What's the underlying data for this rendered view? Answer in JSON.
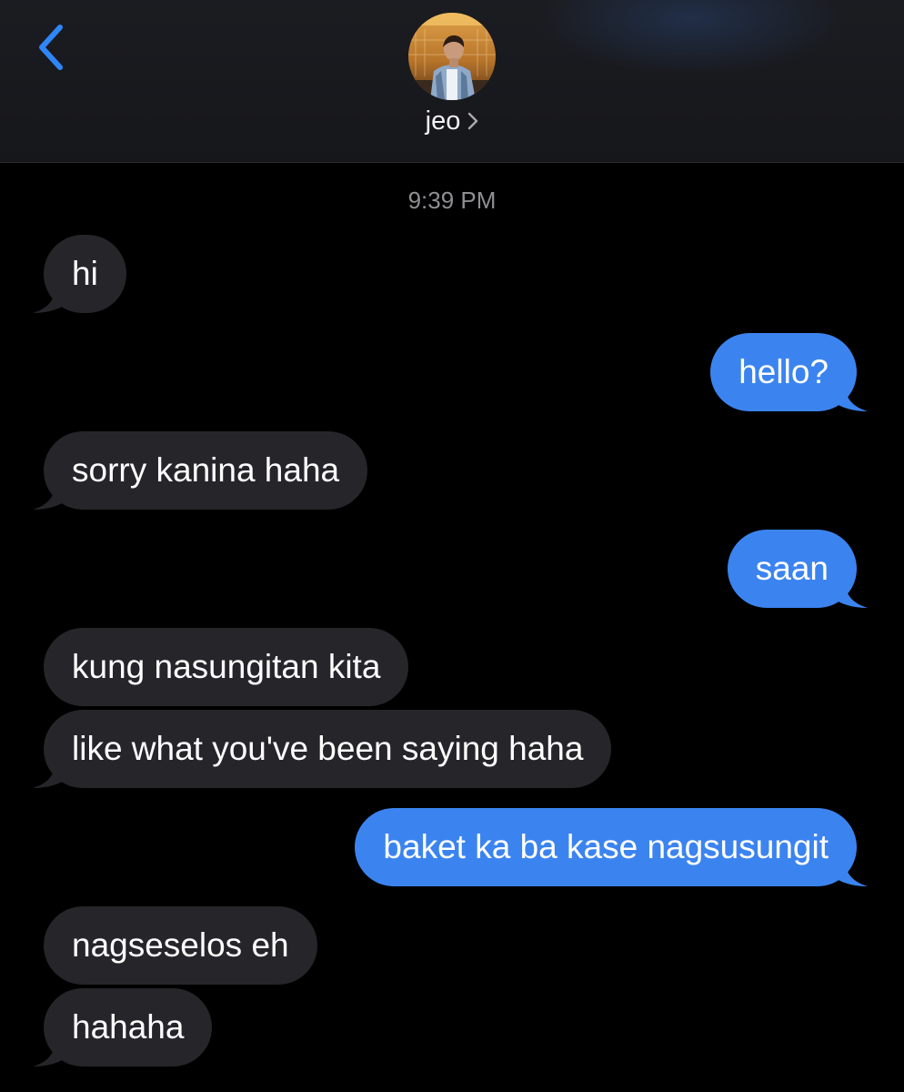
{
  "header": {
    "contact_name": "jeo",
    "avatar_icon": "contact-avatar-photo",
    "back_icon": "chevron-left-icon",
    "accent_color": "#3b84f0"
  },
  "timestamp": "9:39 PM",
  "messages": [
    {
      "direction": "incoming",
      "text": "hi",
      "tail": true
    },
    {
      "direction": "outgoing",
      "text": "hello?",
      "tail": true
    },
    {
      "direction": "incoming",
      "text": "sorry kanina haha",
      "tail": true
    },
    {
      "direction": "outgoing",
      "text": "saan",
      "tail": true
    },
    {
      "direction": "incoming",
      "text": "kung nasungitan kita",
      "tail": false
    },
    {
      "direction": "incoming",
      "text": "like what you've been saying haha",
      "tail": true
    },
    {
      "direction": "outgoing",
      "text": "baket ka ba kase nagsusungit",
      "tail": true
    },
    {
      "direction": "incoming",
      "text": "nagseselos eh",
      "tail": false
    },
    {
      "direction": "incoming",
      "text": "hahaha",
      "tail": true
    }
  ],
  "colors": {
    "incoming_bubble": "#26252a",
    "outgoing_bubble": "#3b84f0",
    "background": "#000000"
  }
}
